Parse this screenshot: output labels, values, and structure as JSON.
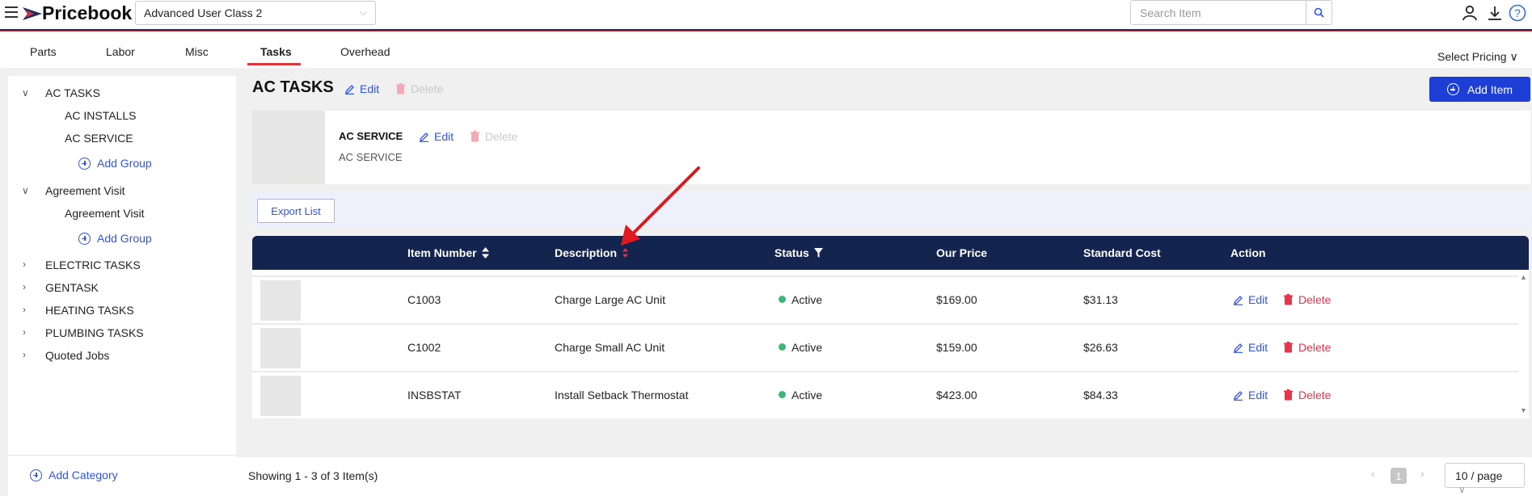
{
  "header": {
    "brand": "Pricebook",
    "class_select_value": "Advanced User Class 2",
    "search_placeholder": "Search Item"
  },
  "tabs": [
    {
      "label": "Parts"
    },
    {
      "label": "Labor"
    },
    {
      "label": "Misc"
    },
    {
      "label": "Tasks",
      "active": true
    },
    {
      "label": "Overhead"
    }
  ],
  "select_pricing": "Select Pricing",
  "sidebar": {
    "tree": [
      {
        "label": "AC TASKS",
        "expanded": true
      },
      {
        "label": "AC INSTALLS"
      },
      {
        "label": "AC SERVICE"
      },
      {
        "label": "Add Group"
      },
      {
        "label": "Agreement Visit",
        "expanded": true
      },
      {
        "label": "Agreement Visit"
      },
      {
        "label": "Add Group"
      },
      {
        "label": "ELECTRIC TASKS"
      },
      {
        "label": "GENTASK"
      },
      {
        "label": "HEATING TASKS"
      },
      {
        "label": "PLUMBING TASKS"
      },
      {
        "label": "Quoted Jobs"
      }
    ],
    "add_category": "Add Category"
  },
  "main": {
    "title": "AC TASKS",
    "edit_label": "Edit",
    "delete_label": "Delete",
    "add_item": "Add Item",
    "group": {
      "name": "AC SERVICE",
      "subtitle": "AC SERVICE",
      "edit_label": "Edit",
      "delete_label": "Delete"
    },
    "export_list": "Export List"
  },
  "table": {
    "columns": [
      "Item Number",
      "Description",
      "Status",
      "Our Price",
      "Standard Cost",
      "Action"
    ],
    "rows": [
      {
        "item_number": "C1003",
        "description": "Charge Large AC Unit",
        "status": "Active",
        "our_price": "$169.00",
        "standard_cost": "$31.13",
        "edit": "Edit",
        "delete": "Delete"
      },
      {
        "item_number": "C1002",
        "description": "Charge Small AC Unit",
        "status": "Active",
        "our_price": "$159.00",
        "standard_cost": "$26.63",
        "edit": "Edit",
        "delete": "Delete"
      },
      {
        "item_number": "INSBSTAT",
        "description": "Install Setback Thermostat",
        "status": "Active",
        "our_price": "$423.00",
        "standard_cost": "$84.33",
        "edit": "Edit",
        "delete": "Delete"
      }
    ]
  },
  "footer": {
    "showing": "Showing 1 - 3 of 3 Item(s)",
    "current_page": "1",
    "page_size": "10 / page"
  },
  "colors": {
    "accent_blue": "#1d3fd6",
    "table_header": "#13244f",
    "danger": "#e8334a",
    "active_green": "#3bb873",
    "annotation_red": "#e0191e"
  }
}
